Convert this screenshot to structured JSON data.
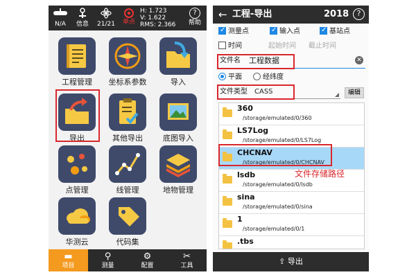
{
  "left": {
    "status": {
      "device": "N/A",
      "info": "信息",
      "satellites": "21/21",
      "solution": "单点",
      "h": "H: 1.723",
      "v": "V: 1.622",
      "rms": "RMS: 2.366",
      "help": "帮助"
    },
    "tiles": [
      {
        "label": "工程管理",
        "icon": "notebook-icon"
      },
      {
        "label": "坐标系参数",
        "icon": "compass-icon"
      },
      {
        "label": "导入",
        "icon": "folder-import-icon"
      },
      {
        "label": "导出",
        "icon": "folder-export-icon"
      },
      {
        "label": "其他导出",
        "icon": "clipboard-check-icon"
      },
      {
        "label": "底图导入",
        "icon": "image-icon"
      },
      {
        "label": "点管理",
        "icon": "points-icon"
      },
      {
        "label": "线管理",
        "icon": "line-graph-icon"
      },
      {
        "label": "地物管理",
        "icon": "layers-icon"
      },
      {
        "label": "华测云",
        "icon": "cloud-icon"
      },
      {
        "label": "代码集",
        "icon": "tag-icon"
      }
    ],
    "nav": [
      {
        "label": "项目",
        "icon": "folder-icon"
      },
      {
        "label": "测量",
        "icon": "survey-icon"
      },
      {
        "label": "配置",
        "icon": "gear-icon"
      },
      {
        "label": "工具",
        "icon": "tools-icon"
      }
    ]
  },
  "right": {
    "header": {
      "back": "←",
      "title": "工程-导出",
      "year": "2018",
      "help": "?"
    },
    "checks": {
      "measure": "测量点",
      "input": "输入点",
      "base": "基站点",
      "time": "时间"
    },
    "time_start_placeholder": "起始时间",
    "time_end_placeholder": "截止时间",
    "filename_label": "文件名",
    "filename_value": "工程数据",
    "coord": {
      "plane": "平面",
      "latlon": "经纬度"
    },
    "filetype_label": "文件类型",
    "filetype_value": "CASS",
    "edit_label": "编辑",
    "files": [
      {
        "name": "360",
        "path": "/storage/emulated/0/360"
      },
      {
        "name": "LS7Log",
        "path": "/storage/emulated/0/LS7Log"
      },
      {
        "name": "CHCNAV",
        "path": "/storage/emulated/0/CHCNAV"
      },
      {
        "name": "lsdb",
        "path": "/storage/emulated/0/lsdb"
      },
      {
        "name": "sina",
        "path": "/storage/emulated/0/sina"
      },
      {
        "name": "1",
        "path": "/storage/emulated/0/1"
      },
      {
        "name": ".tbs",
        "path": ""
      }
    ],
    "annotation": "文件存储路径",
    "export_label": "导出"
  },
  "colors": {
    "accent": "#f49a1f",
    "selected_row": "#a8d8f8",
    "highlight": "#d9262c",
    "tile_bg": "#3f4a6b",
    "check_blue": "#1e88e5"
  }
}
